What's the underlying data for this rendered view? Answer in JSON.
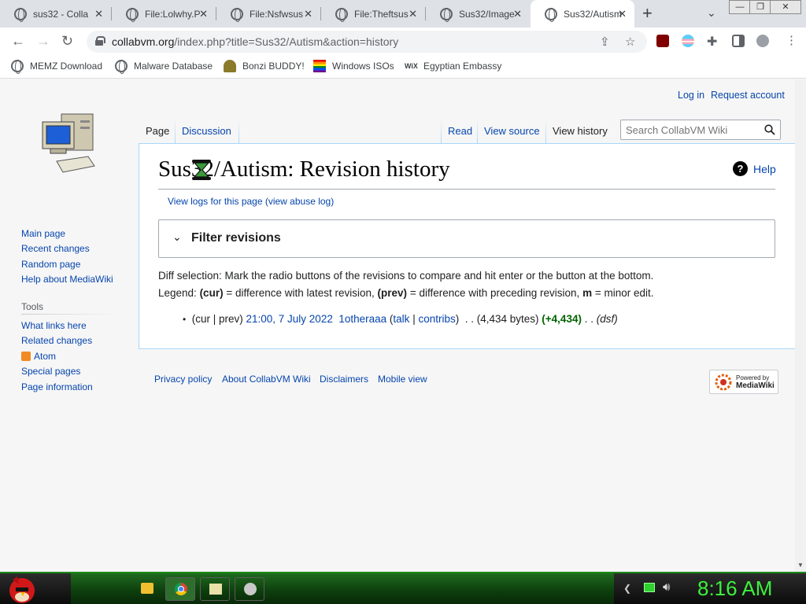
{
  "browser": {
    "tabs": [
      {
        "title": "sus32 - Colla",
        "active": false
      },
      {
        "title": "File:Lolwhy.P",
        "active": false
      },
      {
        "title": "File:Nsfwsus",
        "active": false
      },
      {
        "title": "File:Theftsus",
        "active": false
      },
      {
        "title": "Sus32/Image",
        "active": false
      },
      {
        "title": "Sus32/Autism",
        "active": true
      }
    ],
    "new_tab": "+",
    "window_controls": {
      "minimize": "—",
      "restore": "❐",
      "close": "✕"
    },
    "url_host": "collabvm.org",
    "url_path": "/index.php?title=Sus32/Autism&action=history",
    "bookmarks": [
      "MEMZ Download",
      "Malware Database",
      "Bonzi BUDDY!",
      "Windows ISOs",
      "Egyptian Embassy"
    ]
  },
  "wiki": {
    "personal": {
      "login": "Log in",
      "request": "Request account"
    },
    "namespaces": {
      "page": "Page",
      "discussion": "Discussion"
    },
    "views": {
      "read": "Read",
      "source": "View source",
      "history": "View history"
    },
    "search_placeholder": "Search CollabVM Wiki",
    "title": "Sus32/Autism: Revision history",
    "help": "Help",
    "logs_link": "View logs for this page (view abuse log)",
    "filter_title": "Filter revisions",
    "diff_line": "Diff selection: Mark the radio buttons of the revisions to compare and hit enter or the button at the bottom.",
    "legend": {
      "prefix": "Legend: ",
      "cur": "(cur)",
      "cur_desc": " = difference with latest revision, ",
      "prev": "(prev)",
      "prev_desc": " = difference with preceding revision, ",
      "m": "m",
      "m_desc": " = minor edit."
    },
    "revision": {
      "curprev": "(cur | prev)",
      "date": "21:00, 7 July 2022",
      "user": "1otheraaa",
      "talk": "talk",
      "contribs": "contribs",
      "size": "(4,434 bytes)",
      "diff": "(+4,434)",
      "summary": "(dsf)"
    },
    "navigation": [
      "Main page",
      "Recent changes",
      "Random page",
      "Help about MediaWiki"
    ],
    "tools_heading": "Tools",
    "tools": [
      "What links here",
      "Related changes",
      "Atom",
      "Special pages",
      "Page information"
    ],
    "footer": [
      "Privacy policy",
      "About CollabVM Wiki",
      "Disclaimers",
      "Mobile view"
    ],
    "powered": {
      "line1": "Powered by",
      "line2": "MediaWiki"
    }
  },
  "taskbar": {
    "clock": "8:16 AM"
  }
}
